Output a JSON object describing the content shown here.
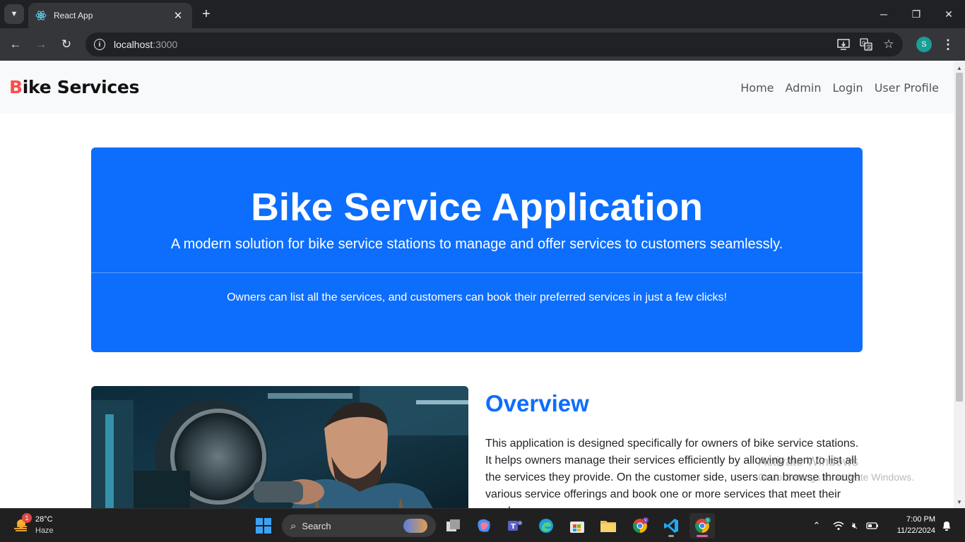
{
  "browser": {
    "tab_title": "React App",
    "url_host": "localhost",
    "url_port": ":3000",
    "profile_initial": "S"
  },
  "navbar": {
    "brand_initial": "B",
    "brand_rest": "ike Services",
    "links": [
      "Home",
      "Admin",
      "Login",
      "User Profile"
    ]
  },
  "hero": {
    "title": "Bike Service Application",
    "lead": "A modern solution for bike service stations to manage and offer services to customers seamlessly.",
    "text": "Owners can list all the services, and customers can book their preferred services in just a few clicks!"
  },
  "overview": {
    "title": "Overview",
    "text": "This application is designed specifically for owners of bike service stations. It helps owners manage their services efficiently by allowing them to list all the services they provide. On the customer side, users can browse through various service offerings and book one or more services that meet their needs."
  },
  "watermark": {
    "title": "Activate Windows",
    "sub": "Go to Settings to activate Windows."
  },
  "taskbar": {
    "weather_badge": "1",
    "temperature": "28°C",
    "condition": "Haze",
    "search_label": "Search",
    "time": "7:00 PM",
    "date": "11/22/2024"
  },
  "colors": {
    "primary": "#0d6efd",
    "brand_accent": "#ff4d4d",
    "navbar_bg": "#f8f9fa"
  }
}
